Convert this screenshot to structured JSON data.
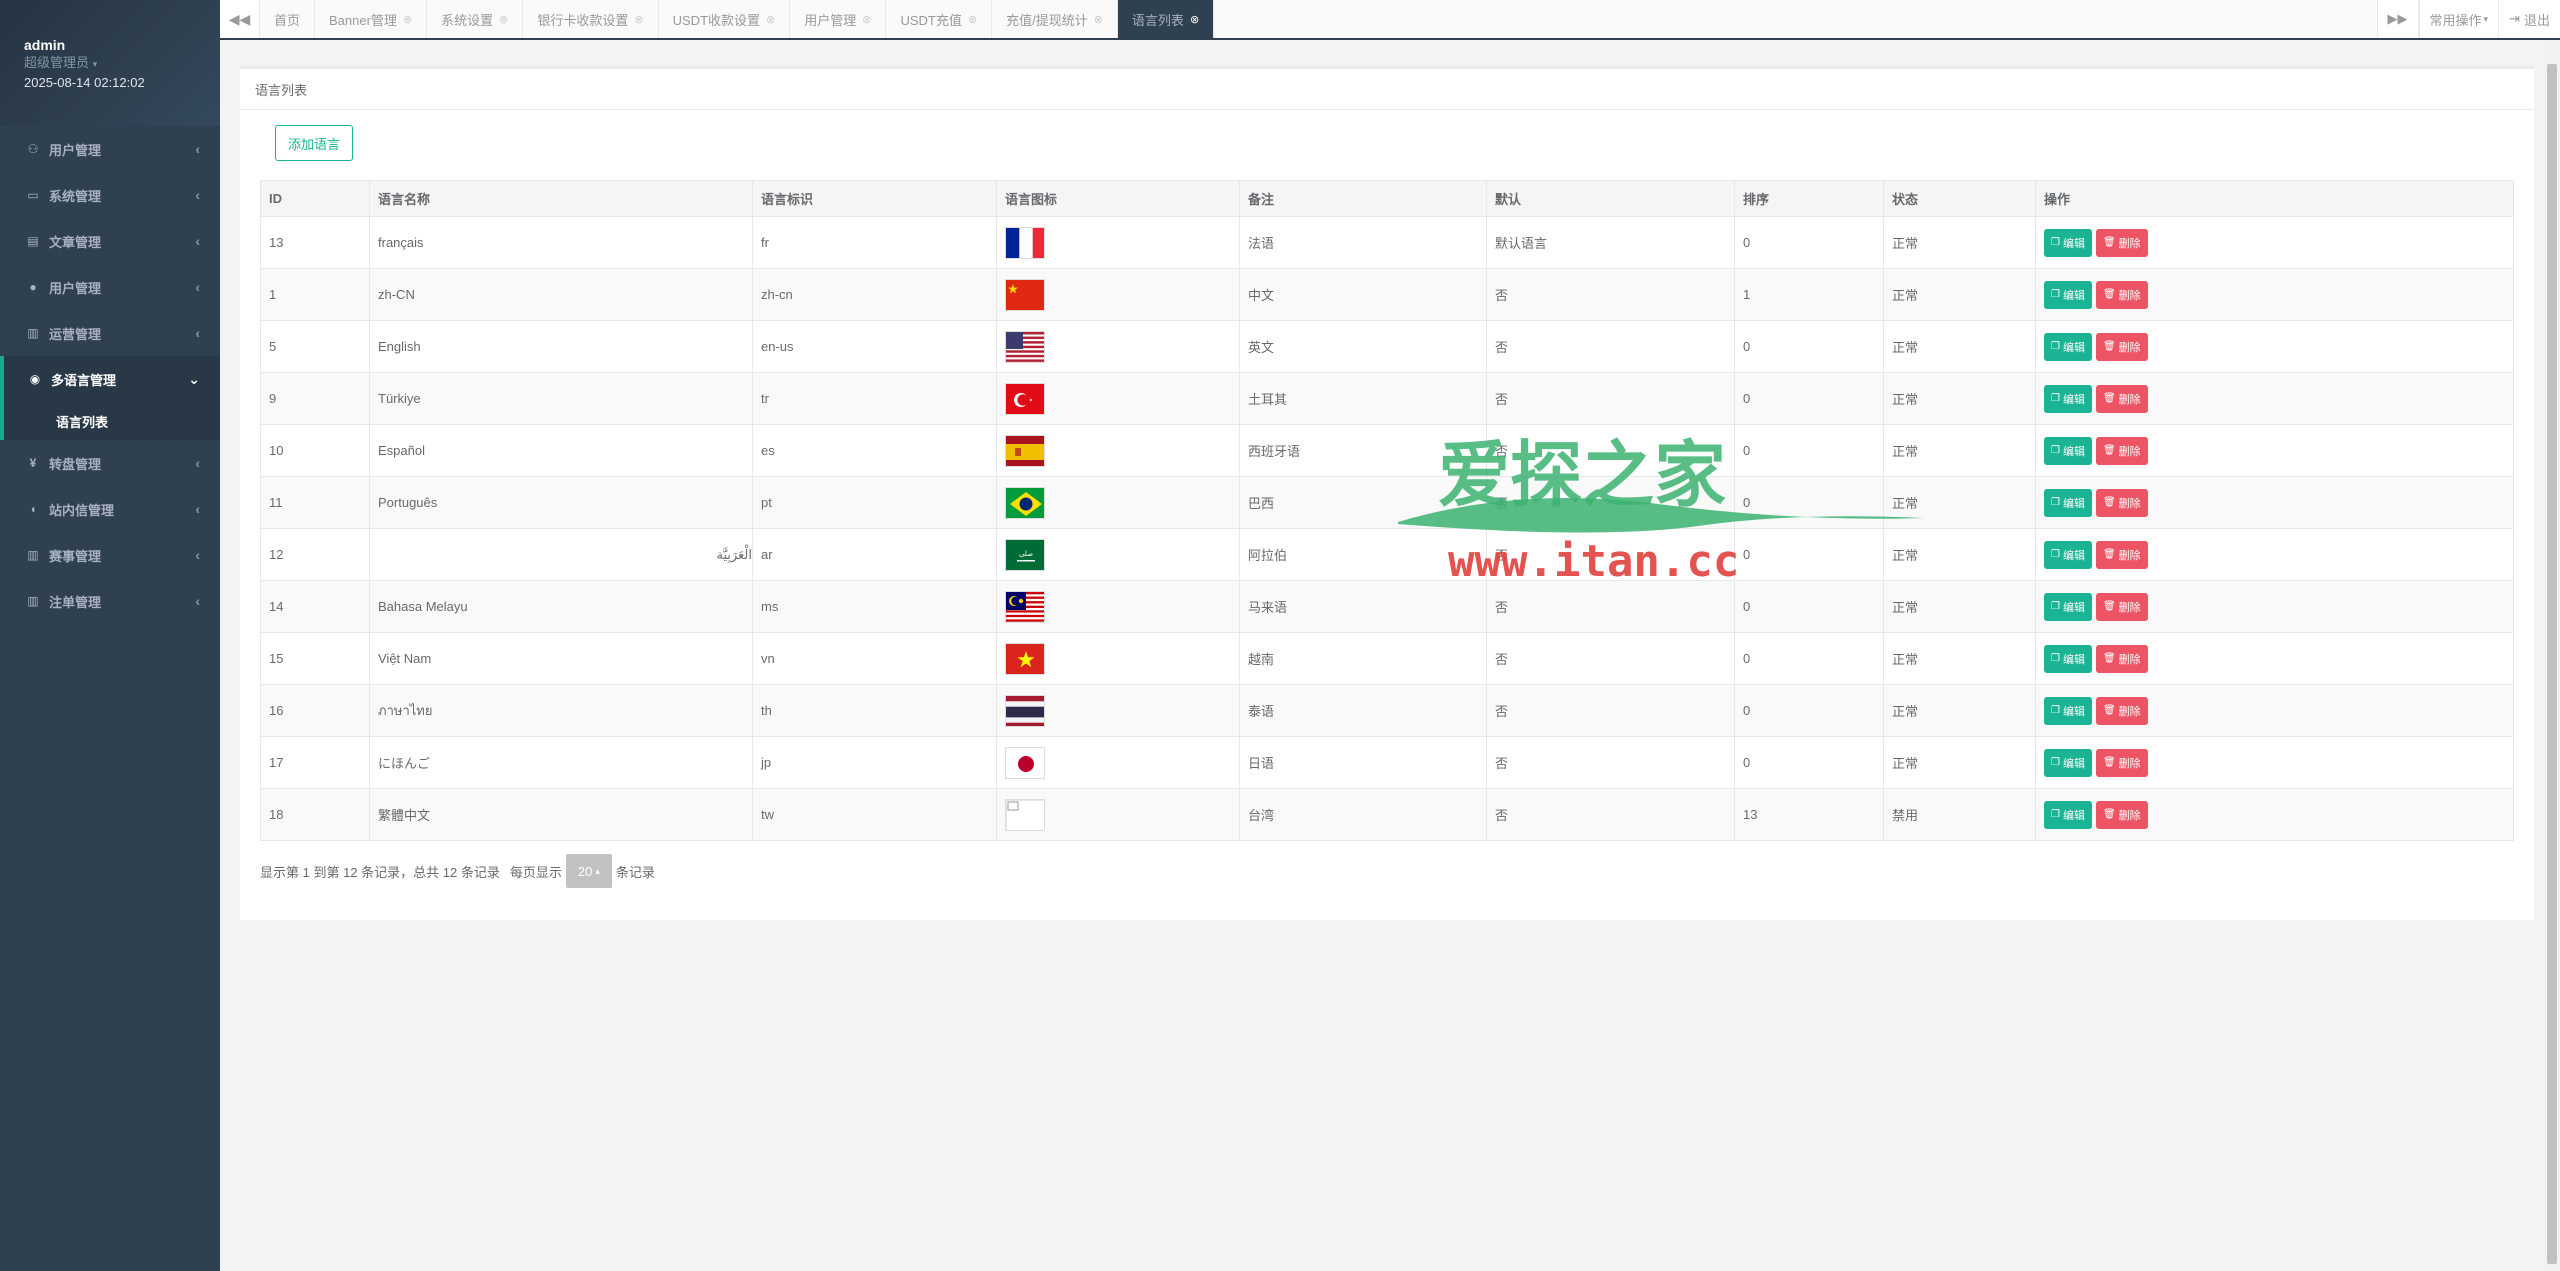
{
  "profile": {
    "name": "admin",
    "role": "超级管理员",
    "time": "2025-08-14 02:12:02"
  },
  "sidebar": {
    "items": [
      {
        "label": "用户管理",
        "icon": "users-icon"
      },
      {
        "label": "系统管理",
        "icon": "desktop-icon"
      },
      {
        "label": "文章管理",
        "icon": "book-icon"
      },
      {
        "label": "用户管理",
        "icon": "user-icon"
      },
      {
        "label": "运营管理",
        "icon": "bar-chart-icon"
      },
      {
        "label": "多语言管理",
        "icon": "globe-icon",
        "active": true,
        "sub": [
          {
            "label": "语言列表"
          }
        ]
      },
      {
        "label": "转盘管理",
        "icon": "yen-icon"
      },
      {
        "label": "站内信管理",
        "icon": "comment-icon"
      },
      {
        "label": "赛事管理",
        "icon": "bar-chart-icon"
      },
      {
        "label": "注单管理",
        "icon": "bar-chart-icon"
      }
    ]
  },
  "tabs": [
    {
      "label": "首页",
      "closable": false
    },
    {
      "label": "Banner管理",
      "closable": true
    },
    {
      "label": "系统设置",
      "closable": true
    },
    {
      "label": "银行卡收款设置",
      "closable": true
    },
    {
      "label": "USDT收款设置",
      "closable": true
    },
    {
      "label": "用户管理",
      "closable": true
    },
    {
      "label": "USDT充值",
      "closable": true
    },
    {
      "label": "充值/提现统计",
      "closable": true
    },
    {
      "label": "语言列表",
      "closable": true,
      "active": true
    }
  ],
  "topbar": {
    "common_ops": "常用操作",
    "logout": "退出"
  },
  "panel": {
    "title": "语言列表",
    "add_button": "添加语言"
  },
  "table": {
    "headers": [
      "ID",
      "语言名称",
      "语言标识",
      "语言图标",
      "备注",
      "默认",
      "排序",
      "状态",
      "操作"
    ],
    "rows": [
      {
        "id": "13",
        "name": "français",
        "code": "fr",
        "flag": "fr",
        "note": "法语",
        "default": "默认语言",
        "sort": "0",
        "status": "正常"
      },
      {
        "id": "1",
        "name": "zh-CN",
        "code": "zh-cn",
        "flag": "cn",
        "note": "中文",
        "default": "否",
        "sort": "1",
        "status": "正常"
      },
      {
        "id": "5",
        "name": "English",
        "code": "en-us",
        "flag": "us",
        "note": "英文",
        "default": "否",
        "sort": "0",
        "status": "正常"
      },
      {
        "id": "9",
        "name": "Türkiye",
        "code": "tr",
        "flag": "tr",
        "note": "土耳其",
        "default": "否",
        "sort": "0",
        "status": "正常"
      },
      {
        "id": "10",
        "name": "Español",
        "code": "es",
        "flag": "es",
        "note": "西班牙语",
        "default": "否",
        "sort": "0",
        "status": "正常"
      },
      {
        "id": "11",
        "name": "Português",
        "code": "pt",
        "flag": "br",
        "note": "巴西",
        "default": "否",
        "sort": "0",
        "status": "正常"
      },
      {
        "id": "12",
        "name": "الْعَرَبِيَّة",
        "code": "ar",
        "flag": "sa",
        "note": "阿拉伯",
        "default": "否",
        "sort": "0",
        "status": "正常"
      },
      {
        "id": "14",
        "name": "Bahasa Melayu",
        "code": "ms",
        "flag": "my",
        "note": "马来语",
        "default": "否",
        "sort": "0",
        "status": "正常"
      },
      {
        "id": "15",
        "name": "Việt Nam",
        "code": "vn",
        "flag": "vn",
        "note": "越南",
        "default": "否",
        "sort": "0",
        "status": "正常"
      },
      {
        "id": "16",
        "name": "ภาษาไทย",
        "code": "th",
        "flag": "th",
        "note": "泰语",
        "default": "否",
        "sort": "0",
        "status": "正常"
      },
      {
        "id": "17",
        "name": "にほんご",
        "code": "jp",
        "flag": "jp",
        "note": "日语",
        "default": "否",
        "sort": "0",
        "status": "正常"
      },
      {
        "id": "18",
        "name": "繁體中文",
        "code": "tw",
        "flag": "broken",
        "note": "台湾",
        "default": "否",
        "sort": "13",
        "status": "禁用"
      }
    ],
    "edit_label": "编辑",
    "delete_label": "删除"
  },
  "pager": {
    "summary": "显示第 1 到第 12 条记录，总共 12 条记录",
    "per_page_prefix": "每页显示",
    "page_size": "20",
    "per_page_suffix": "条记录"
  },
  "watermark": {
    "title": "爱探之家",
    "url": "www.itan.cc",
    "color": "#3cb371"
  }
}
